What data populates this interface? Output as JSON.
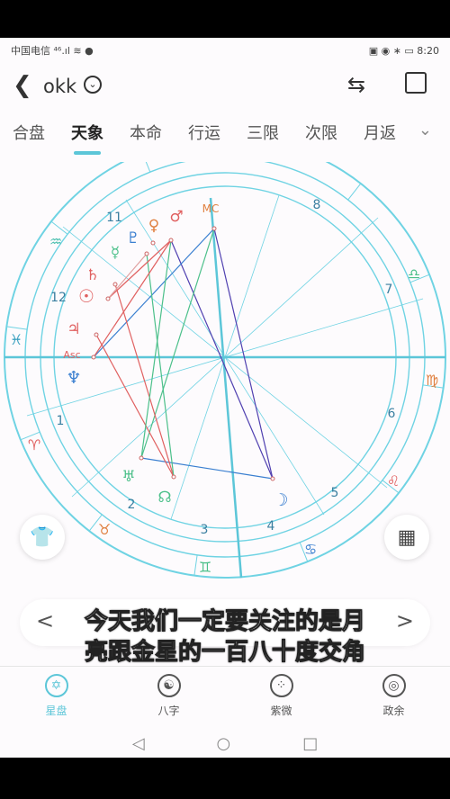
{
  "status": {
    "carrier": "中国电信 ⁴⁶.ıl ≋ ●",
    "time": "8:20",
    "icons": "▣ ◉ ∗ ▭"
  },
  "header": {
    "title": "okk",
    "back_icon": "chevron-left",
    "swap_icon": "swap-arrows",
    "share_icon": "external-link"
  },
  "tabs": [
    {
      "label": "合盘"
    },
    {
      "label": "天象",
      "active": true
    },
    {
      "label": "本命"
    },
    {
      "label": "行运"
    },
    {
      "label": "三限"
    },
    {
      "label": "次限"
    },
    {
      "label": "月返"
    }
  ],
  "chart": {
    "houses": [
      "1",
      "2",
      "3",
      "4",
      "5",
      "6",
      "7",
      "8",
      "11",
      "12"
    ],
    "signs": [
      "♒",
      "♓",
      "♈",
      "♉",
      "♊",
      "♋",
      "♌",
      "♍",
      "♎"
    ],
    "planets": [
      {
        "glyph": "MC",
        "name": "mc"
      },
      {
        "glyph": "♂",
        "name": "mars"
      },
      {
        "glyph": "♀",
        "name": "venus"
      },
      {
        "glyph": "♇",
        "name": "pluto"
      },
      {
        "glyph": "☿",
        "name": "mercury"
      },
      {
        "glyph": "♄",
        "name": "saturn"
      },
      {
        "glyph": "☉",
        "name": "sun"
      },
      {
        "glyph": "♃",
        "name": "jupiter"
      },
      {
        "glyph": "Asc",
        "name": "asc"
      },
      {
        "glyph": "♆",
        "name": "neptune"
      },
      {
        "glyph": "♅",
        "name": "uranus"
      },
      {
        "glyph": "☊",
        "name": "node"
      },
      {
        "glyph": "☽",
        "name": "moon"
      }
    ],
    "colors": {
      "ring": "#6fd3e3",
      "axis": "#5cc6d8",
      "red": "#e06060",
      "green": "#4cc08a",
      "blue": "#3a7fd0",
      "purple": "#5040b0"
    }
  },
  "fabs": {
    "left_icon": "shirt",
    "right_icon": "grid-blocks"
  },
  "datebar": {
    "prev": "<",
    "next": ">"
  },
  "subtitle": [
    "今天我们一定要关注的是月",
    "亮跟金星的一百八十度交角"
  ],
  "nav": [
    {
      "label": "星盘",
      "icon": "✡",
      "active": true
    },
    {
      "label": "八字",
      "icon": "☯"
    },
    {
      "label": "紫微",
      "icon": "⁘"
    },
    {
      "label": "政余",
      "icon": "◎"
    }
  ],
  "sysnav": {
    "back": "◁",
    "home": "○",
    "recent": "□"
  }
}
